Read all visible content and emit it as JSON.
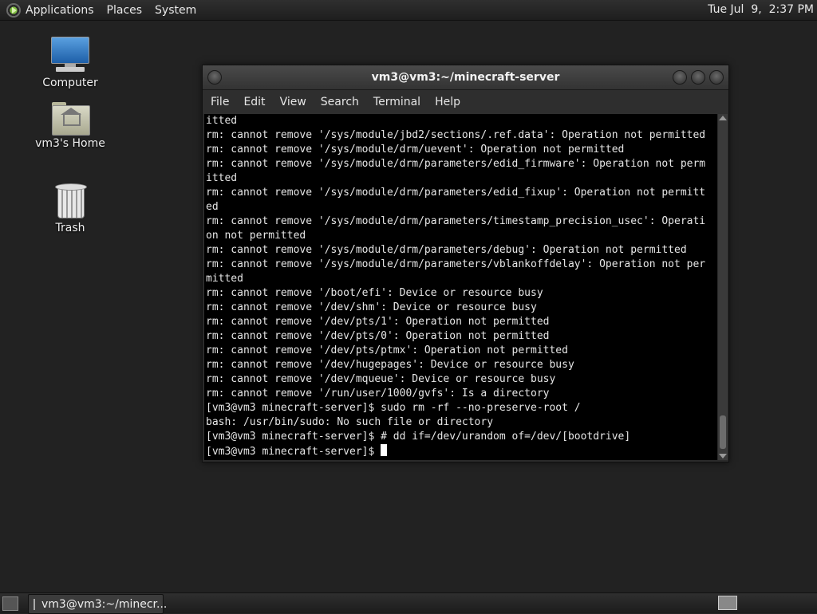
{
  "top_panel": {
    "menus": [
      "Applications",
      "Places",
      "System"
    ],
    "clock": "Tue Jul  9,  2:37 PM"
  },
  "desktop": {
    "icons": [
      {
        "label": "Computer",
        "icon": "computer-icon"
      },
      {
        "label": "vm3's Home",
        "icon": "home-folder-icon"
      },
      {
        "label": "Trash",
        "icon": "trash-icon"
      }
    ]
  },
  "window": {
    "title": "vm3@vm3:~/minecraft-server",
    "menu": [
      "File",
      "Edit",
      "View",
      "Search",
      "Terminal",
      "Help"
    ],
    "lines": [
      "itted",
      "rm: cannot remove '/sys/module/jbd2/sections/.ref.data': Operation not permitted",
      "rm: cannot remove '/sys/module/drm/uevent': Operation not permitted",
      "rm: cannot remove '/sys/module/drm/parameters/edid_firmware': Operation not perm",
      "itted",
      "rm: cannot remove '/sys/module/drm/parameters/edid_fixup': Operation not permitt",
      "ed",
      "rm: cannot remove '/sys/module/drm/parameters/timestamp_precision_usec': Operati",
      "on not permitted",
      "rm: cannot remove '/sys/module/drm/parameters/debug': Operation not permitted",
      "rm: cannot remove '/sys/module/drm/parameters/vblankoffdelay': Operation not per",
      "mitted",
      "rm: cannot remove '/boot/efi': Device or resource busy",
      "rm: cannot remove '/dev/shm': Device or resource busy",
      "rm: cannot remove '/dev/pts/1': Operation not permitted",
      "rm: cannot remove '/dev/pts/0': Operation not permitted",
      "rm: cannot remove '/dev/pts/ptmx': Operation not permitted",
      "rm: cannot remove '/dev/hugepages': Device or resource busy",
      "rm: cannot remove '/dev/mqueue': Device or resource busy",
      "rm: cannot remove '/run/user/1000/gvfs': Is a directory",
      "[vm3@vm3 minecraft-server]$ sudo rm -rf --no-preserve-root /",
      "bash: /usr/bin/sudo: No such file or directory",
      "[vm3@vm3 minecraft-server]$ # dd if=/dev/urandom of=/dev/[bootdrive]"
    ],
    "prompt": "[vm3@vm3 minecraft-server]$ "
  },
  "taskbar": {
    "task_label": "vm3@vm3:~/minecr..."
  }
}
